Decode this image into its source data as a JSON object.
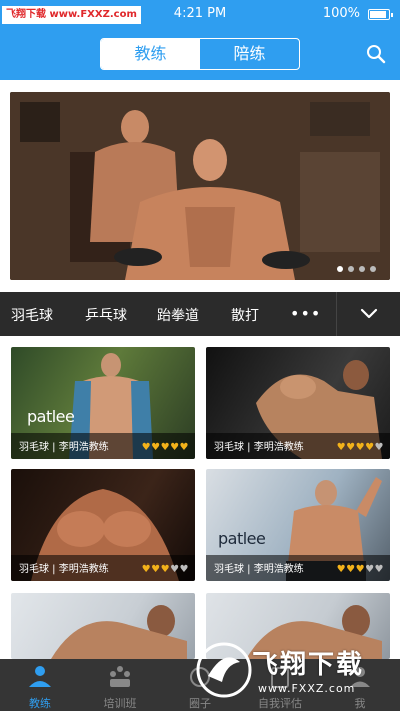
{
  "status_bar": {
    "watermark_badge": "飞翔下载 www.FXXZ.com",
    "time": "4:21 PM",
    "battery": "100%",
    "battery_level": 1.0
  },
  "nav": {
    "tabs": [
      {
        "label": "教练",
        "active": true
      },
      {
        "label": "陪练",
        "active": false
      }
    ],
    "search_icon": "search-icon"
  },
  "banner": {
    "page_count": 4,
    "active_page": 0
  },
  "categories": {
    "items": [
      "羽毛球",
      "乒乓球",
      "跆拳道",
      "散打"
    ],
    "more": "•••",
    "expand_icon": "chevron-down-icon"
  },
  "coaches": [
    {
      "caption": "羽毛球 | 李明浩教练",
      "rating": 5,
      "logo": "patlee"
    },
    {
      "caption": "羽毛球 | 李明浩教练",
      "rating": 4,
      "logo": ""
    },
    {
      "caption": "羽毛球 | 李明浩教练",
      "rating": 3,
      "logo": ""
    },
    {
      "caption": "羽毛球 | 李明浩教练",
      "rating": 3,
      "logo": "patlee"
    },
    {
      "caption": "",
      "rating": 0,
      "logo": ""
    },
    {
      "caption": "",
      "rating": 0,
      "logo": ""
    }
  ],
  "tabbar": {
    "items": [
      {
        "label": "教练",
        "icon": "coach-icon",
        "active": true
      },
      {
        "label": "培训班",
        "icon": "class-icon",
        "active": false
      },
      {
        "label": "圈子",
        "icon": "circle-icon",
        "active": false
      },
      {
        "label": "自我评估",
        "icon": "assess-icon",
        "active": false
      },
      {
        "label": "我",
        "icon": "profile-icon",
        "active": false
      }
    ]
  },
  "watermark": {
    "text": "飞翔下载",
    "url": "www.FXXZ.com"
  },
  "colors": {
    "primary": "#2f9ef0",
    "category_bar": "#2b2b2b",
    "rating_on": "#f3b21a",
    "rating_off": "#bdbdbd"
  }
}
